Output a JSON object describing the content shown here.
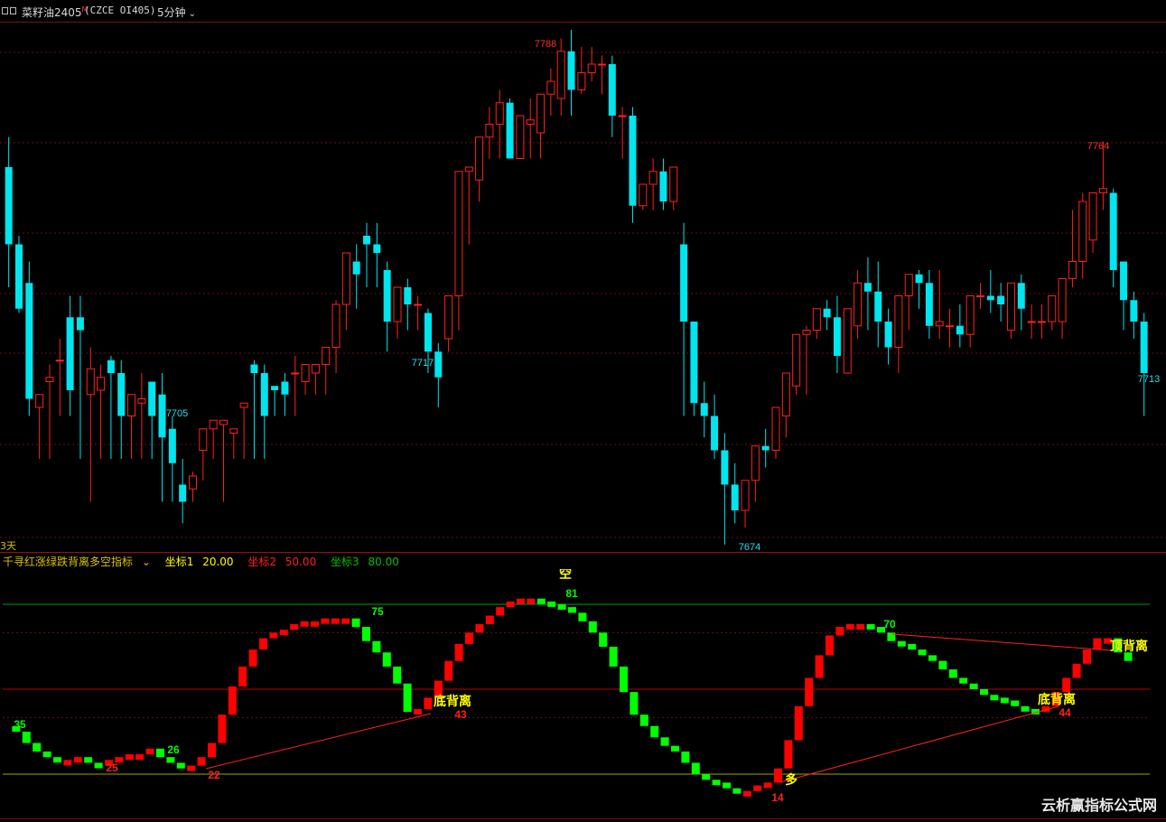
{
  "header": {
    "instrument": "菜籽油2405",
    "main_flag": "M",
    "code": "(CZCE OI405)",
    "period": "5分钟"
  },
  "colors": {
    "up": "#ff2020",
    "down": "#00e5ee",
    "grid": "#6a1010",
    "label_up": "#ff3030",
    "label_down": "#20e0f0",
    "bar_red": "#ff0000",
    "bar_green": "#00ff00",
    "yellow": "#ffff00"
  },
  "main_chart": {
    "price_markers": [
      {
        "text": "7788",
        "type": "high"
      },
      {
        "text": "7705",
        "type": "low"
      },
      {
        "text": "7717",
        "type": "low"
      },
      {
        "text": "7674",
        "type": "low"
      },
      {
        "text": "7764",
        "type": "high"
      },
      {
        "text": "7713",
        "type": "last"
      }
    ],
    "cut_label": "3天",
    "candles": [
      [
        7758,
        7765,
        7740,
        7730
      ],
      [
        7740,
        7742,
        7725,
        7724
      ],
      [
        7731,
        7736,
        7704,
        7700
      ],
      [
        7702,
        7703,
        7705,
        7690
      ],
      [
        7708,
        7712,
        7709,
        7690
      ],
      [
        7713,
        7718,
        7713,
        7700
      ],
      [
        7723,
        7728,
        7706,
        7700
      ],
      [
        7723,
        7728,
        7720,
        7690
      ],
      [
        7705,
        7716,
        7711,
        7680
      ],
      [
        7706,
        7712,
        7709,
        7690
      ],
      [
        7713,
        7714,
        7710,
        7690
      ],
      [
        7710,
        7713,
        7700,
        7690
      ],
      [
        7700,
        7705,
        7705,
        7690
      ],
      [
        7703,
        7710,
        7704,
        7690
      ],
      [
        7708,
        7708,
        7700,
        7690
      ],
      [
        7705,
        7710,
        7695,
        7680
      ],
      [
        7697,
        7700,
        7689,
        7680
      ],
      [
        7684,
        7690,
        7680,
        7675
      ],
      [
        7683,
        7687,
        7686,
        7680
      ],
      [
        7692,
        7695,
        7697,
        7685
      ],
      [
        7697,
        7698,
        7699,
        7690
      ],
      [
        7698,
        7698,
        7699,
        7680
      ],
      [
        7696,
        7697,
        7697,
        7690
      ],
      [
        7702,
        7703,
        7703,
        7690
      ],
      [
        7712,
        7713,
        7710,
        7690
      ],
      [
        7710,
        7712,
        7700,
        7690
      ],
      [
        7707,
        7707,
        7706,
        7700
      ],
      [
        7708,
        7710,
        7705,
        7700
      ],
      [
        7710,
        7714,
        7710,
        7700
      ],
      [
        7708,
        7710,
        7712,
        7705
      ],
      [
        7710,
        7712,
        7712,
        7705
      ],
      [
        7712,
        7716,
        7716,
        7705
      ],
      [
        7716,
        7727,
        7726,
        7710
      ],
      [
        7726,
        7737,
        7738,
        7720
      ],
      [
        7736,
        7740,
        7733,
        7725
      ],
      [
        7742,
        7745,
        7740,
        7730
      ],
      [
        7740,
        7745,
        7738,
        7730
      ],
      [
        7734,
        7736,
        7722,
        7715
      ],
      [
        7722,
        7725,
        7730,
        7718
      ],
      [
        7730,
        7732,
        7726,
        7720
      ],
      [
        7726,
        7728,
        7726,
        7720
      ],
      [
        7724,
        7725,
        7715,
        7710
      ],
      [
        7715,
        7717,
        7709,
        7702
      ],
      [
        7718,
        7720,
        7728,
        7715
      ],
      [
        7728,
        7757,
        7757,
        7720
      ],
      [
        7757,
        7758,
        7758,
        7740
      ],
      [
        7755,
        7764,
        7765,
        7750
      ],
      [
        7765,
        7772,
        7768,
        7760
      ],
      [
        7768,
        7776,
        7773,
        7760
      ],
      [
        7773,
        7774,
        7760,
        7760
      ],
      [
        7760,
        7765,
        7770,
        7760
      ],
      [
        7768,
        7774,
        7769,
        7760
      ],
      [
        7766,
        7770,
        7775,
        7760
      ],
      [
        7775,
        7781,
        7778,
        7770
      ],
      [
        7774,
        7788,
        7785,
        7770
      ],
      [
        7785,
        7790,
        7776,
        7770
      ],
      [
        7776,
        7786,
        7780,
        7775
      ],
      [
        7780,
        7786,
        7782,
        7778
      ],
      [
        7782,
        7784,
        7782,
        7775
      ],
      [
        7782,
        7784,
        7770,
        7765
      ],
      [
        7770,
        7772,
        7770,
        7760
      ],
      [
        7770,
        7772,
        7749,
        7745
      ],
      [
        7749,
        7752,
        7754,
        7748
      ],
      [
        7754,
        7760,
        7757,
        7748
      ],
      [
        7757,
        7760,
        7750,
        7748
      ],
      [
        7750,
        7758,
        7758,
        7748
      ],
      [
        7740,
        7745,
        7722,
        7700
      ],
      [
        7722,
        7722,
        7703,
        7700
      ],
      [
        7703,
        7708,
        7700,
        7695
      ],
      [
        7700,
        7705,
        7692,
        7690
      ],
      [
        7692,
        7696,
        7684,
        7670
      ],
      [
        7684,
        7689,
        7678,
        7675
      ],
      [
        7678,
        7680,
        7685,
        7674
      ],
      [
        7685,
        7693,
        7693,
        7680
      ],
      [
        7693,
        7697,
        7692,
        7688
      ],
      [
        7692,
        7702,
        7702,
        7690
      ],
      [
        7700,
        7710,
        7710,
        7695
      ],
      [
        7707,
        7712,
        7719,
        7705
      ],
      [
        7719,
        7721,
        7720,
        7705
      ],
      [
        7720,
        7724,
        7725,
        7718
      ],
      [
        7725,
        7727,
        7723,
        7720
      ],
      [
        7723,
        7728,
        7714,
        7710
      ],
      [
        7710,
        7720,
        7725,
        7710
      ],
      [
        7721,
        7734,
        7731,
        7718
      ],
      [
        7731,
        7737,
        7729,
        7720
      ],
      [
        7729,
        7736,
        7722,
        7716
      ],
      [
        7722,
        7725,
        7716,
        7712
      ],
      [
        7716,
        7724,
        7728,
        7710
      ],
      [
        7728,
        7732,
        7733,
        7720
      ],
      [
        7733,
        7734,
        7731,
        7725
      ],
      [
        7731,
        7734,
        7721,
        7718
      ],
      [
        7721,
        7734,
        7722,
        7718
      ],
      [
        7721,
        7725,
        7721,
        7716
      ],
      [
        7721,
        7726,
        7719,
        7716
      ],
      [
        7719,
        7726,
        7728,
        7716
      ],
      [
        7728,
        7731,
        7728,
        7725
      ],
      [
        7728,
        7734,
        7727,
        7724
      ],
      [
        7728,
        7731,
        7726,
        7722
      ],
      [
        7720,
        7727,
        7731,
        7718
      ],
      [
        7731,
        7733,
        7725,
        7720
      ],
      [
        7722,
        7726,
        7722,
        7718
      ],
      [
        7722,
        7726,
        7722,
        7718
      ],
      [
        7722,
        7728,
        7728,
        7720
      ],
      [
        7722,
        7732,
        7732,
        7718
      ],
      [
        7732,
        7748,
        7736,
        7730
      ],
      [
        7736,
        7752,
        7750,
        7732
      ],
      [
        7741,
        7750,
        7752,
        7738
      ],
      [
        7752,
        7764,
        7753,
        7748
      ],
      [
        7752,
        7753,
        7734,
        7730
      ],
      [
        7736,
        7736,
        7727,
        7720
      ],
      [
        7727,
        7729,
        7722,
        7718
      ],
      [
        7722,
        7724,
        7710,
        7700
      ]
    ],
    "candle_count": 114
  },
  "sub_chart": {
    "indicator_name": "千寻红涨绿跌背离多空指标",
    "coord1": {
      "label": "坐标1",
      "value": "20.00"
    },
    "coord2": {
      "label": "坐标2",
      "value": "50.00"
    },
    "coord3": {
      "label": "坐标3",
      "value": "80.00"
    },
    "values": [
      37,
      35,
      31,
      28,
      26,
      25,
      25,
      26,
      24,
      23,
      25,
      26,
      27,
      27,
      29,
      26,
      24,
      22,
      23,
      26,
      31,
      41,
      51,
      58,
      64,
      68,
      70,
      71,
      73,
      74,
      74,
      75,
      75,
      75,
      72,
      67,
      63,
      58,
      52,
      42,
      43,
      47,
      53,
      60,
      66,
      70,
      73,
      76,
      79,
      81,
      82,
      82,
      81,
      80,
      79,
      77,
      74,
      70,
      65,
      58,
      49,
      41,
      37,
      33,
      30,
      28,
      24,
      20,
      18,
      17,
      15,
      14,
      14,
      16,
      17,
      22,
      32,
      44,
      54,
      62,
      69,
      72,
      73,
      73,
      72,
      70,
      67,
      66,
      64,
      62,
      60,
      57,
      54,
      52,
      50,
      48,
      47,
      46,
      44,
      43,
      42,
      44,
      49,
      54,
      59,
      64,
      68,
      68,
      63,
      60
    ],
    "labels": [
      {
        "text": "35",
        "color": "green"
      },
      {
        "text": "25",
        "color": "red"
      },
      {
        "text": "26",
        "color": "green"
      },
      {
        "text": "22",
        "color": "red"
      },
      {
        "text": "75",
        "color": "green"
      },
      {
        "text": "43",
        "color": "red"
      },
      {
        "text": "81",
        "color": "green"
      },
      {
        "text": "14",
        "color": "red"
      },
      {
        "text": "70",
        "color": "green"
      },
      {
        "text": "44",
        "color": "red"
      }
    ],
    "signals": [
      {
        "text": "底背离"
      },
      {
        "text": "空"
      },
      {
        "text": "多"
      },
      {
        "text": "底背离"
      },
      {
        "text": "顶背离"
      }
    ]
  },
  "watermark": "云析赢指标公式网"
}
